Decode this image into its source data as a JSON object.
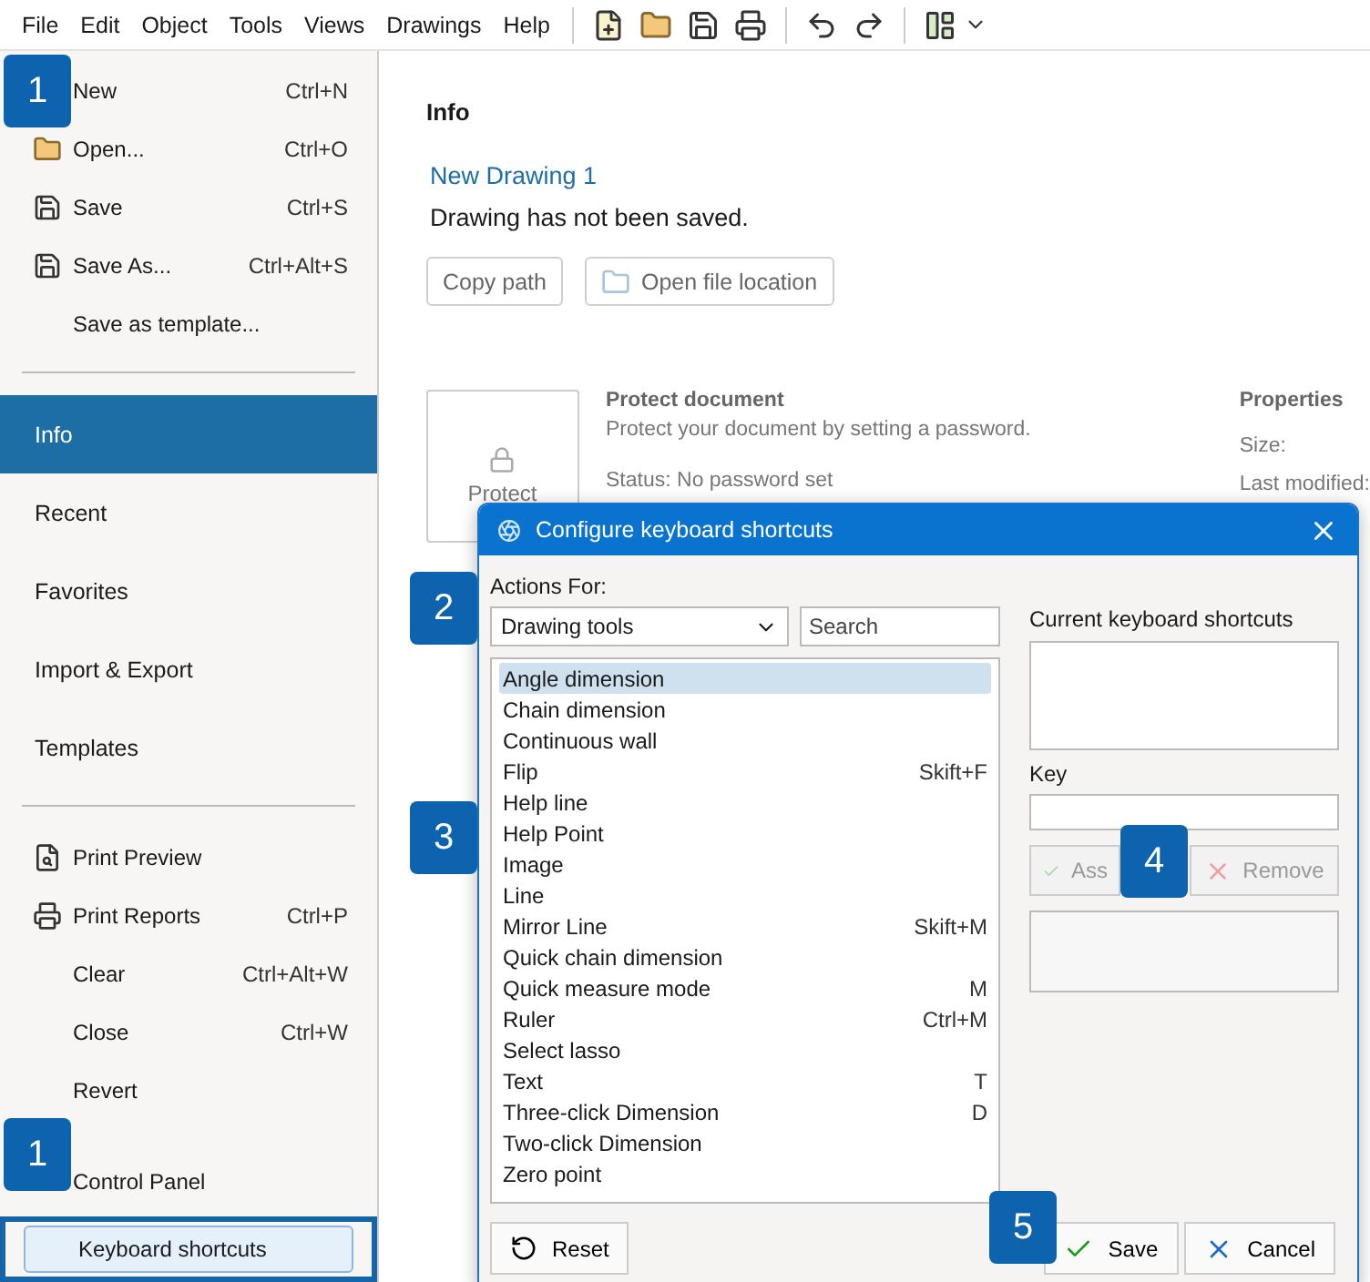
{
  "menu_bar": {
    "menus": [
      "File",
      "Edit",
      "Object",
      "Tools",
      "Views",
      "Drawings",
      "Help"
    ]
  },
  "file_menu": {
    "commands": [
      {
        "label": "New",
        "shortcut": "Ctrl+N",
        "kind": "plain",
        "selected": false
      },
      {
        "label": "Open...",
        "shortcut": "Ctrl+O",
        "kind": "folder",
        "selected": false
      },
      {
        "label": "Save",
        "shortcut": "Ctrl+S",
        "kind": "disk",
        "selected": false
      },
      {
        "label": "Save As...",
        "shortcut": "Ctrl+Alt+S",
        "kind": "disk",
        "selected": false
      },
      {
        "label": "Save as template...",
        "kind": "plain",
        "selected": false
      }
    ],
    "sections": [
      {
        "label": "Info",
        "selected": true
      },
      {
        "label": "Recent",
        "selected": false
      },
      {
        "label": "Favorites",
        "selected": false
      },
      {
        "label": "Import & Export",
        "selected": false
      },
      {
        "label": "Templates",
        "selected": false
      }
    ],
    "tools": [
      {
        "label": "Print Preview",
        "kind": "preview",
        "selected": false
      },
      {
        "label": "Print Reports",
        "shortcut": "Ctrl+P",
        "kind": "printer",
        "selected": false
      },
      {
        "label": "Clear",
        "shortcut": "Ctrl+Alt+W",
        "kind": "plain",
        "selected": false
      },
      {
        "label": "Close",
        "shortcut": "Ctrl+W",
        "kind": "plain",
        "selected": false
      },
      {
        "label": "Revert",
        "kind": "plain",
        "selected": false
      }
    ],
    "settings": [
      {
        "label": "Control Panel",
        "selected": false
      },
      {
        "label": "Keyboard shortcuts",
        "selected": true
      }
    ]
  },
  "info": {
    "title": "Info",
    "document_name": "New Drawing 1",
    "save_status": "Drawing has not been saved.",
    "buttons": [
      "Copy path",
      "Open file location"
    ],
    "protect": {
      "card_label": "Protect",
      "heading": "Protect document",
      "description": "Protect your document by setting a password.",
      "status": "Status: No password set"
    },
    "properties": {
      "heading": "Properties",
      "labels": [
        "Size:",
        "Last modified:"
      ]
    }
  },
  "dialog": {
    "title": "Configure keyboard shortcuts",
    "actions_label": "Actions For:",
    "category": "Drawing tools",
    "search_placeholder": "Search",
    "actions": [
      {
        "name": "Angle dimension",
        "selected": true
      },
      {
        "name": "Chain dimension",
        "selected": false
      },
      {
        "name": "Continuous wall",
        "selected": false
      },
      {
        "name": "Flip",
        "shortcut": "Skift+F",
        "selected": false
      },
      {
        "name": "Help line",
        "selected": false
      },
      {
        "name": "Help Point",
        "selected": false
      },
      {
        "name": "Image",
        "selected": false
      },
      {
        "name": "Line",
        "selected": false
      },
      {
        "name": "Mirror Line",
        "shortcut": "Skift+M",
        "selected": false
      },
      {
        "name": "Quick chain dimension",
        "selected": false
      },
      {
        "name": "Quick measure mode",
        "shortcut": "M",
        "selected": false
      },
      {
        "name": "Ruler",
        "shortcut": "Ctrl+M",
        "selected": false
      },
      {
        "name": "Select lasso",
        "selected": false
      },
      {
        "name": "Text",
        "shortcut": "T",
        "selected": false
      },
      {
        "name": "Three-click Dimension",
        "shortcut": "D",
        "selected": false
      },
      {
        "name": "Two-click Dimension",
        "selected": false
      },
      {
        "name": "Zero point",
        "selected": false
      }
    ],
    "current_label": "Current keyboard shortcuts",
    "key_label": "Key",
    "assign": {
      "label": "Ass",
      "disabled": true
    },
    "remove": {
      "label": "Remove",
      "disabled": true
    },
    "reset": "Reset",
    "save": "Save",
    "cancel": "Cancel"
  },
  "callouts": [
    "1",
    "2",
    "3",
    "4",
    "5",
    "1"
  ]
}
